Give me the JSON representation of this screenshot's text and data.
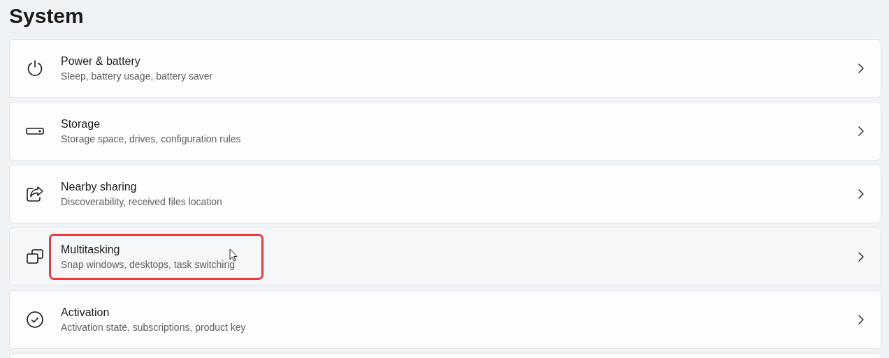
{
  "page": {
    "title": "System"
  },
  "items": [
    {
      "kind": "power",
      "title": "Power & battery",
      "subtitle": "Sleep, battery usage, battery saver",
      "hovered": false,
      "highlighted": false
    },
    {
      "kind": "storage",
      "title": "Storage",
      "subtitle": "Storage space, drives, configuration rules",
      "hovered": false,
      "highlighted": false
    },
    {
      "kind": "share",
      "title": "Nearby sharing",
      "subtitle": "Discoverability, received files location",
      "hovered": false,
      "highlighted": false
    },
    {
      "kind": "multitask",
      "title": "Multitasking",
      "subtitle": "Snap windows, desktops, task switching",
      "hovered": true,
      "highlighted": true
    },
    {
      "kind": "check",
      "title": "Activation",
      "subtitle": "Activation state, subscriptions, product key",
      "hovered": false,
      "highlighted": false
    }
  ]
}
